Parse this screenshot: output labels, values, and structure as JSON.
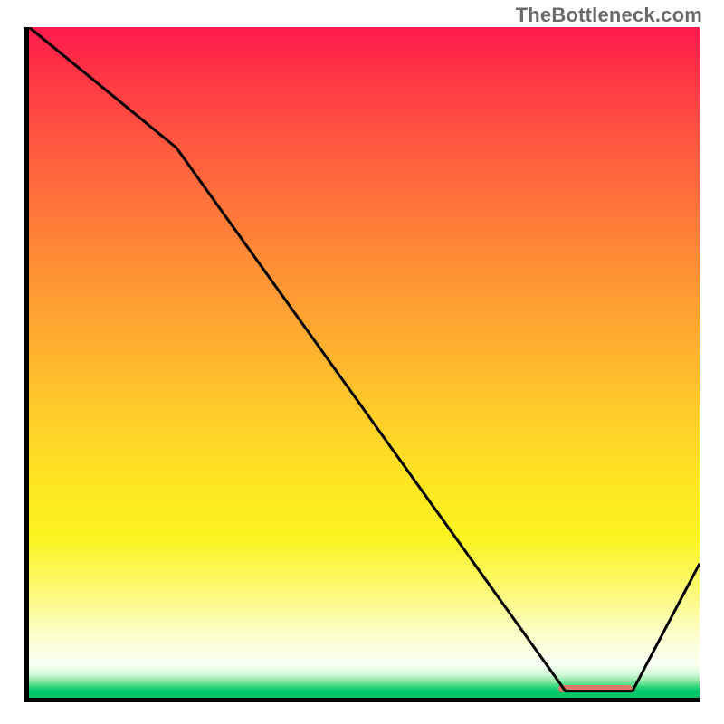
{
  "attribution": "TheBottleneck.com",
  "chart_data": {
    "type": "line",
    "title": "",
    "xlabel": "",
    "ylabel": "",
    "xlim": [
      0,
      100
    ],
    "ylim": [
      0,
      100
    ],
    "x": [
      0,
      22,
      80,
      90,
      100
    ],
    "values": [
      100,
      82,
      1,
      1,
      20
    ],
    "minimum_marker": {
      "x_start": 79,
      "x_end": 90,
      "y": 0.8
    },
    "background_gradient": {
      "orientation": "vertical",
      "stops": [
        {
          "pos": 0,
          "color": "#ff1a4d"
        },
        {
          "pos": 50,
          "color": "#ffb72e"
        },
        {
          "pos": 80,
          "color": "#fcf85d"
        },
        {
          "pos": 99,
          "color": "#00c96a"
        },
        {
          "pos": 100,
          "color": "#00c46b"
        }
      ]
    }
  }
}
